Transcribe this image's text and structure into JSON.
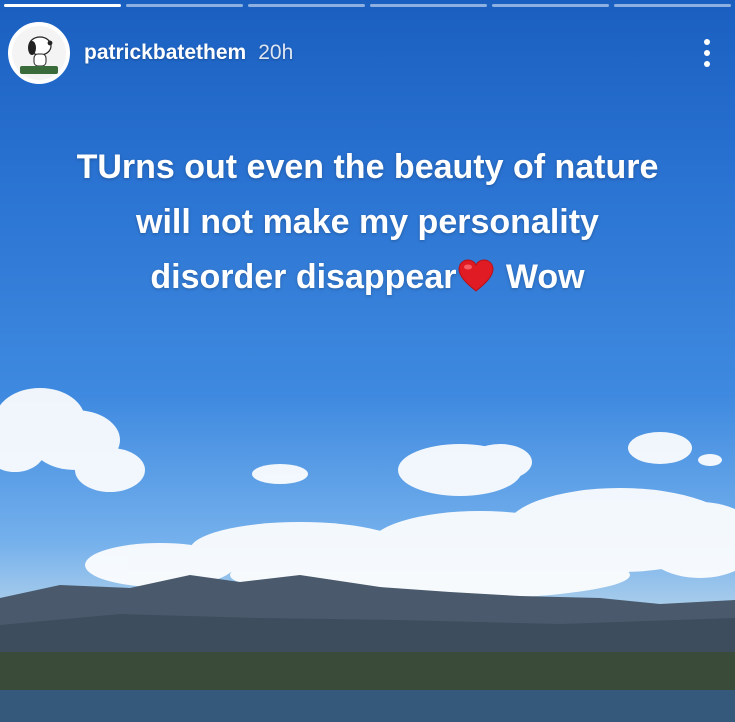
{
  "progress": {
    "segments_total": 6,
    "segments_completed": 1
  },
  "account": {
    "username": "patrickbatethem",
    "time": "20h"
  },
  "menu": {
    "icon": "more-vertical-icon"
  },
  "caption": {
    "line1": "TUrns out even the beauty of nature",
    "line2": "will not make my personality",
    "line3_before": "disorder disappear",
    "emoji": "red-heart",
    "line3_after": "Wow"
  },
  "colors": {
    "sky_top": "#1a5fc0",
    "sky_mid": "#3f8ae0",
    "clouds": "#ffffff",
    "mountains": "#4a5a6c",
    "water": "#34597a",
    "heart": "#e01b24"
  }
}
